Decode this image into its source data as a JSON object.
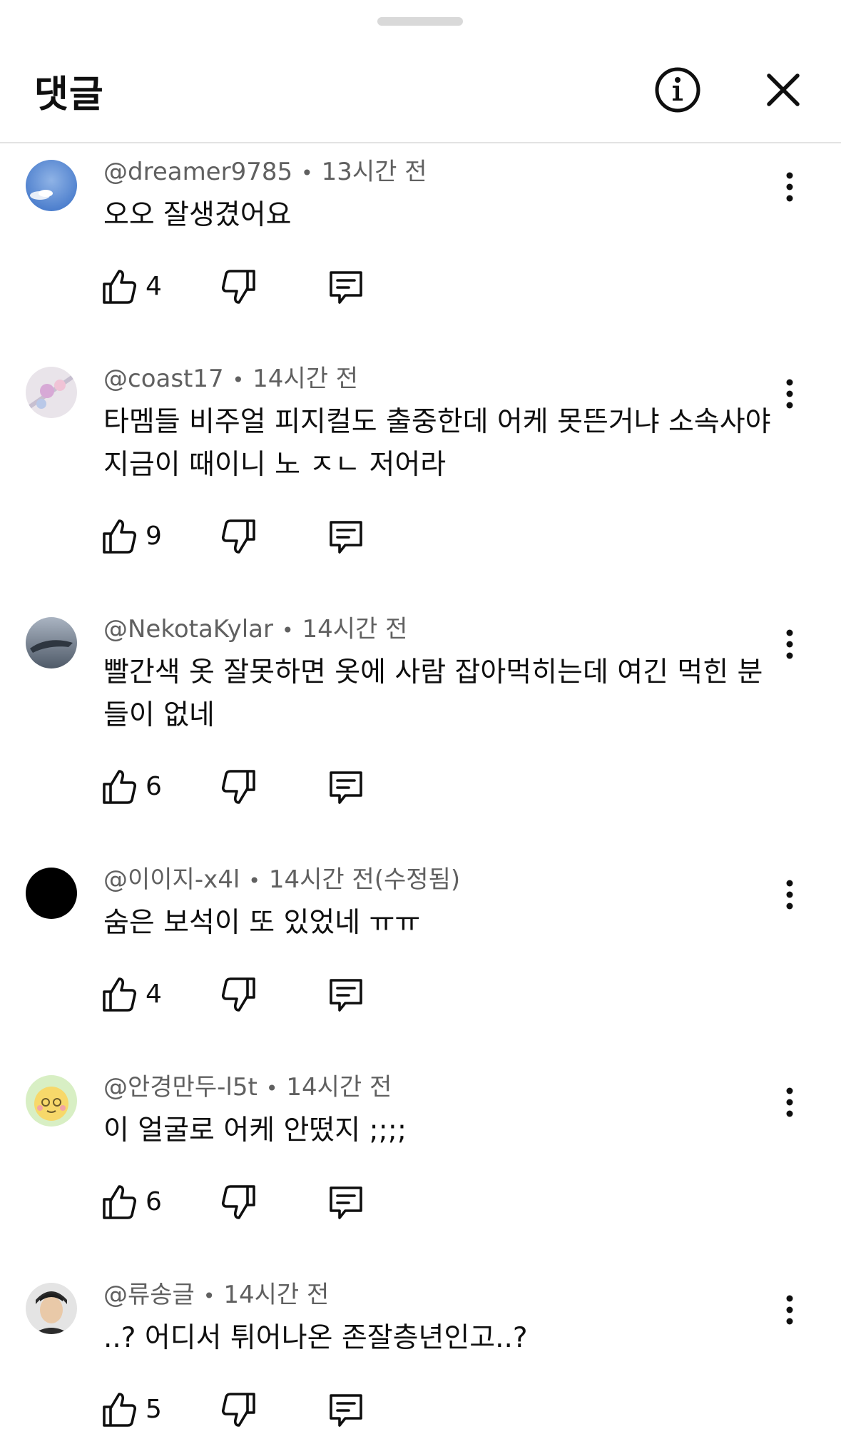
{
  "header": {
    "title": "댓글"
  },
  "icons": {
    "info": "info-icon",
    "close": "close-icon",
    "more": "more-vert-icon",
    "like": "thumb-up-icon",
    "dislike": "thumb-down-icon",
    "reply": "reply-comment-icon"
  },
  "comments": [
    {
      "author": "@dreamer9785",
      "time": "13시간 전",
      "lines": [
        "오오 잘생겼어요"
      ],
      "likes": "4"
    },
    {
      "author": "@coast17",
      "time": "14시간 전",
      "lines": [
        "타멤들 비주얼 피지컬도 출중한데 어케 못뜬거냐 소속사야",
        "지금이 때이니 노 ㅈㄴ 저어라"
      ],
      "likes": "9"
    },
    {
      "author": "@NekotaKylar",
      "time": "14시간 전",
      "lines": [
        "빨간색 옷 잘못하면 옷에 사람 잡아먹히는데 여긴 먹힌 분",
        "들이 없네"
      ],
      "likes": "6"
    },
    {
      "author": "@이이지-x4l",
      "time": "14시간 전(수정됨)",
      "lines": [
        "숨은 보석이 또 있었네 ㅠㅠ"
      ],
      "likes": "4"
    },
    {
      "author": "@안경만두-l5t",
      "time": "14시간 전",
      "lines": [
        "이 얼굴로 어케 안떴지 ;;;;"
      ],
      "likes": "6"
    },
    {
      "author": "@류송글",
      "time": "14시간 전",
      "lines": [
        "..? 어디서 튀어나온 존잘층년인고..?"
      ],
      "likes": "5"
    }
  ]
}
